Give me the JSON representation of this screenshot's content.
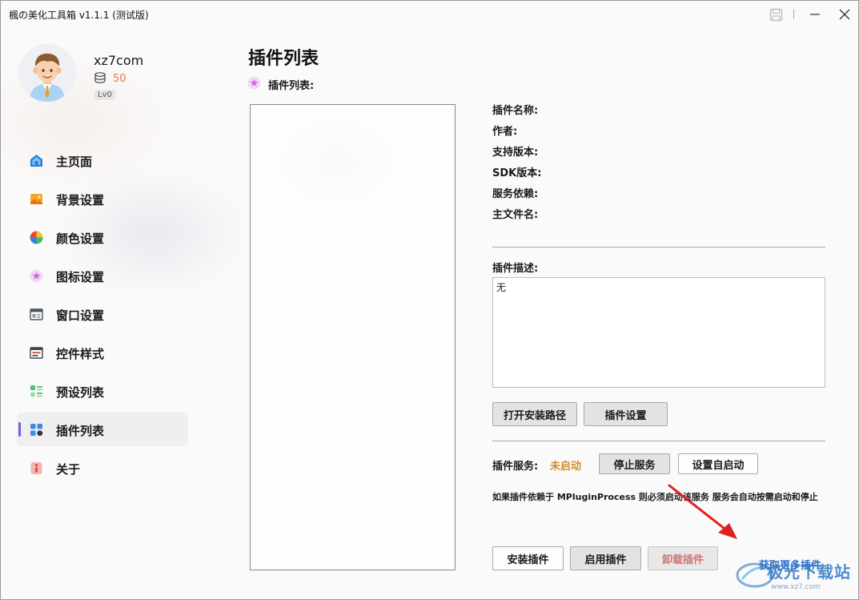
{
  "window": {
    "title": "楓の美化工具箱 v1.1.1 (测试版)"
  },
  "profile": {
    "username": "xz7com",
    "coins": "50",
    "level": "Lv0"
  },
  "sidebar": {
    "items": [
      {
        "label": "主页面",
        "icon": "home-icon",
        "active": false
      },
      {
        "label": "背景设置",
        "icon": "image-icon",
        "active": false
      },
      {
        "label": "颜色设置",
        "icon": "color-wheel-icon",
        "active": false
      },
      {
        "label": "图标设置",
        "icon": "star-badge-icon",
        "active": false
      },
      {
        "label": "窗口设置",
        "icon": "window-icon",
        "active": false
      },
      {
        "label": "控件样式",
        "icon": "control-icon",
        "active": false
      },
      {
        "label": "预设列表",
        "icon": "preset-list-icon",
        "active": false
      },
      {
        "label": "插件列表",
        "icon": "plugin-grid-icon",
        "active": true
      },
      {
        "label": "关于",
        "icon": "info-icon",
        "active": false
      }
    ]
  },
  "main": {
    "title": "插件列表",
    "list_label": "插件列表:",
    "info": {
      "name_label": "插件名称:",
      "author_label": "作者:",
      "version_label": "支持版本:",
      "sdk_label": "SDK版本:",
      "deps_label": "服务依赖:",
      "file_label": "主文件名:"
    },
    "description_label": "插件描述:",
    "description_value": "无",
    "buttons": {
      "open_path": "打开安装路径",
      "plugin_settings": "插件设置",
      "stop_service": "停止服务",
      "autostart": "设置自启动",
      "install": "安装插件",
      "enable": "启用插件",
      "uninstall": "卸载插件"
    },
    "service": {
      "label": "插件服务:",
      "status": "未启动",
      "status_color": "#d38a2d",
      "note": "如果插件依赖于 MPluginProcess 则必须启动该服务 服务会自动按需启动和停止"
    },
    "more_link": "获取更多插件"
  },
  "watermark": {
    "text": "极光下载站",
    "sub": "www.xz7.com"
  },
  "colors": {
    "accent": "#6f5fd8",
    "link": "#2f6fc9",
    "arrow": "#e02020",
    "coins": "#e07a3c"
  }
}
